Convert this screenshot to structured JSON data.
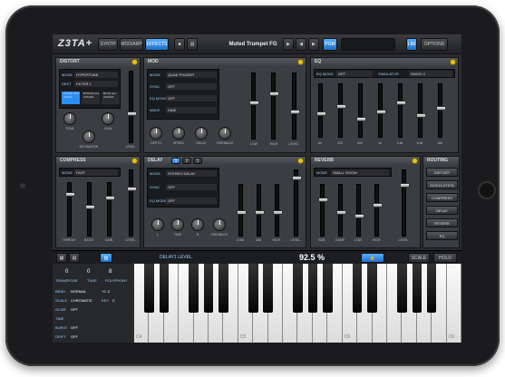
{
  "header": {
    "logo": "Z3TA+",
    "tabs": [
      "SYNTH",
      "MOD/ARP",
      "EFFECTS"
    ],
    "preset": "Muted Trumpet FG",
    "pgm": "PGM",
    "lim": "LIM",
    "options": "OPTIONS"
  },
  "distort": {
    "title": "DISTORT",
    "mode_label": "MODE",
    "mode": "HYPERTUBE",
    "dest_label": "DEST",
    "dest": "FILTER 1",
    "voices": [
      "FILTER PER VOICE",
      "BYPASS ALL VOICES",
      "BOTH ALL VOICES"
    ],
    "knobs": [
      "TONE",
      "GAIN",
      "DECIMATOR"
    ],
    "fader": "LEVEL"
  },
  "mod": {
    "title": "MOD",
    "mode_label": "MODE",
    "mode": "QUAD PHASER",
    "sync_label": "SYNC",
    "sync": "OFF",
    "eqmode_label": "EQ MODE",
    "eqmode": "OFF",
    "wave_label": "WAVE",
    "wave": "SINE",
    "knobs": [
      "DEPTH",
      "SPEED",
      "DELAY",
      "FEEDBACK"
    ],
    "faders": [
      "LOW",
      "HIGH",
      "LEVEL"
    ]
  },
  "eq": {
    "title": "EQ",
    "mode_label": "EQ MODE",
    "mode": "OFF",
    "sim_label": "SIMULATOR",
    "sim": "RADIO 2",
    "bands": [
      "80",
      "220",
      "500",
      "1k",
      "2.5k",
      "6.3k",
      "16k"
    ]
  },
  "compress": {
    "title": "COMPRESS",
    "mode_label": "MODE",
    "mode": "FAST",
    "faders": [
      "THRESH",
      "RATIO",
      "GAIN",
      "LEVEL"
    ]
  },
  "delay": {
    "title": "DELAY",
    "taps": [
      "1",
      "2",
      "3"
    ],
    "mode_label": "MODE",
    "mode": "STEREO DELAY",
    "sync_label": "SYNC",
    "sync": "OFF",
    "eqmode_label": "EQ MODE",
    "eqmode": "OFF",
    "knobs": [
      "L",
      "TIME",
      "R",
      "FEEDBACK"
    ],
    "faders": [
      "LOW",
      "MID",
      "HIGH",
      "LEVEL"
    ]
  },
  "reverb": {
    "title": "REVERB",
    "mode_label": "MODE",
    "mode": "SMALL ROOM",
    "faders": [
      "SIZE",
      "DAMP",
      "LOW",
      "HIGH",
      "LEVEL"
    ]
  },
  "routing": {
    "title": "ROUTING",
    "items": [
      "DISTORT",
      "MODULATION",
      "COMPRESS",
      "DELAY",
      "REVERB",
      "EQ"
    ]
  },
  "kbbar": {
    "param": "DELAY1 LEVEL",
    "value": "92.5 %",
    "scale": "SCALE",
    "hold": "HOLD"
  },
  "side": {
    "transpose": "TRANSPOSE",
    "tune": "TUNE",
    "poly": "POLYPHONY",
    "tv": "0",
    "tuv": "0",
    "pv": "8",
    "bend": "BEND",
    "bendv": "NORMAL",
    "bendr": "+2 -2",
    "scale": "SCALE",
    "scalev": "CHROMATIC",
    "key": "KEY",
    "keyv": "C",
    "glide": "GLIDE",
    "glidev": "OFF",
    "time": "TIME",
    "burst": "BURST",
    "burstv": "OFF",
    "drift": "DRIFT",
    "driftv": "OFF"
  },
  "keys": {
    "c4": "C4",
    "c5": "C5",
    "c6": "C6"
  },
  "colors": {
    "accent": "#2a8ef0",
    "knob_power": "#e8c21b"
  }
}
